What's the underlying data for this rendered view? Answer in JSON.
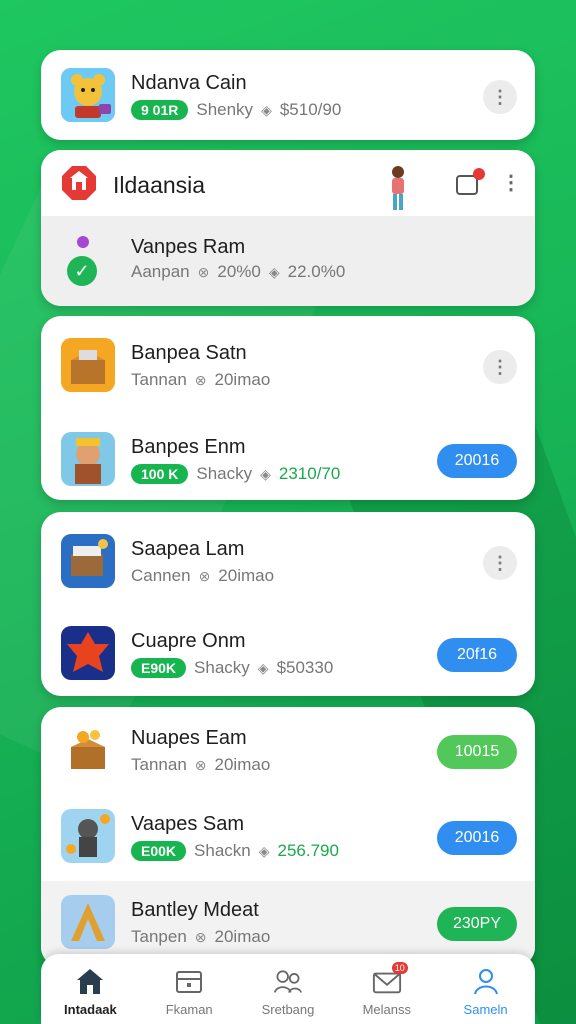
{
  "card1": {
    "title": "Ndanva Cain",
    "pill": "9 01R",
    "meta_name": "Shenky",
    "meta_price": "$510/90"
  },
  "card2": {
    "header_title": "Ildaansia",
    "row_title": "Vanpes Ram",
    "meta_name": "Aanpan",
    "meta_a": "20%0",
    "meta_b": "22.0%0"
  },
  "card3": {
    "row1": {
      "title": "Banpea Satn",
      "meta_name": "Tannan",
      "meta_val": "20imao"
    },
    "row2": {
      "title": "Banpes Enm",
      "pill": "100 K",
      "meta_name": "Shacky",
      "meta_val": "2310/70",
      "button": "20016"
    }
  },
  "card4": {
    "row1": {
      "title": "Saapea Lam",
      "meta_name": "Cannen",
      "meta_val": "20imao"
    },
    "row2": {
      "title": "Cuapre Onm",
      "pill": "E90K",
      "meta_name": "Shacky",
      "meta_val": "$50330",
      "button": "20f16"
    }
  },
  "card5": {
    "row1": {
      "title": "Nuapes Eam",
      "meta_name": "Tannan",
      "meta_val": "20imao",
      "button": "10015"
    },
    "row2": {
      "title": "Vaapes Sam",
      "pill": "E00K",
      "meta_name": "Shackn",
      "meta_val": "256.790",
      "button": "20016"
    },
    "row3": {
      "title": "Bantley Mdeat",
      "meta_name": "Tanpen",
      "meta_val": "20imao",
      "button": "230PY"
    }
  },
  "tabs": [
    {
      "label": "Intadaak",
      "icon": "home-icon"
    },
    {
      "label": "Fkaman",
      "icon": "shop-icon"
    },
    {
      "label": "Sretbang",
      "icon": "people-icon"
    },
    {
      "label": "Melanss",
      "icon": "mail-icon",
      "badge": "10"
    },
    {
      "label": "Sameln",
      "icon": "profile-icon"
    }
  ],
  "colors": {
    "accent_green": "#17b54f",
    "button_blue": "#2f8ef0",
    "background": "#1fc760"
  }
}
